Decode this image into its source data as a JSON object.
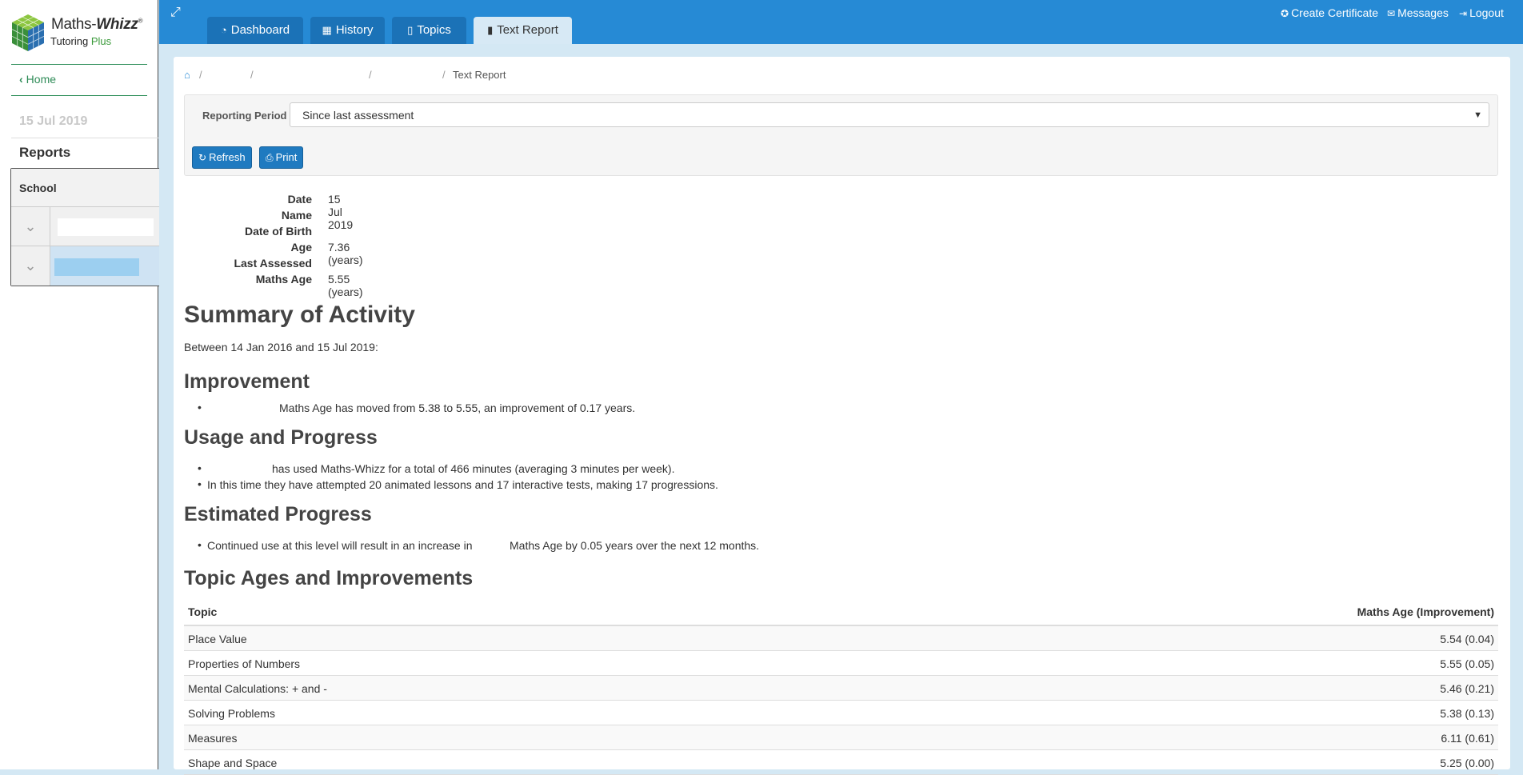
{
  "brand": {
    "name_prefix": "Maths-",
    "name_bold": "Whizz",
    "reg": "®",
    "sub_main": "Tutoring ",
    "sub_accent": "Plus"
  },
  "sidebar": {
    "home_label": "Home",
    "date": "15 Jul 2019",
    "reports_label": "Reports",
    "school_label": "School"
  },
  "topbar": {
    "tabs": [
      {
        "label": "Dashboard",
        "icon": "dashboard-icon"
      },
      {
        "label": "History",
        "icon": "calendar-icon"
      },
      {
        "label": "Topics",
        "icon": "book-icon"
      },
      {
        "label": "Text Report",
        "icon": "file-icon",
        "active": true
      }
    ],
    "right_links": [
      {
        "label": "Create Certificate",
        "icon": "certificate-icon"
      },
      {
        "label": "Messages",
        "icon": "envelope-icon"
      },
      {
        "label": "Logout",
        "icon": "logout-icon"
      }
    ]
  },
  "breadcrumb": {
    "current": "Text Report"
  },
  "filter": {
    "label": "Reporting Period",
    "selected": "Since last assessment",
    "refresh_label": "Refresh",
    "print_label": "Print"
  },
  "info": [
    {
      "key": "Date",
      "value": "15 Jul 2019"
    },
    {
      "key": "Name",
      "value": ""
    },
    {
      "key": "Date of Birth",
      "value": ""
    },
    {
      "key": "Age",
      "value": "7.36 (years)"
    },
    {
      "key": "Last Assessed",
      "value": ""
    },
    {
      "key": "Maths Age",
      "value": "5.55 (years)"
    }
  ],
  "summary": {
    "title": "Summary of Activity",
    "between": "Between 14 Jan 2016 and 15 Jul 2019:",
    "improvement_title": "Improvement",
    "improvement_text": "Maths Age has moved from 5.38 to 5.55, an improvement of 0.17 years.",
    "usage_title": "Usage and Progress",
    "usage_text_1": "has used Maths-Whizz for a total of 466 minutes (averaging 3 minutes per week).",
    "usage_text_2": "In this time they have attempted 20 animated lessons and 17 interactive tests, making 17 progressions.",
    "estimated_title": "Estimated Progress",
    "estimated_text_a": "Continued use at this level will result in an increase in",
    "estimated_text_b": "Maths Age by 0.05 years over the next 12 months."
  },
  "topic_table": {
    "title": "Topic Ages and Improvements",
    "col_topic": "Topic",
    "col_age": "Maths Age (Improvement)",
    "rows": [
      {
        "topic": "Place Value",
        "age": "5.54 (0.04)"
      },
      {
        "topic": "Properties of Numbers",
        "age": "5.55 (0.05)"
      },
      {
        "topic": "Mental Calculations: + and -",
        "age": "5.46 (0.21)"
      },
      {
        "topic": "Solving Problems",
        "age": "5.38 (0.13)"
      },
      {
        "topic": "Measures",
        "age": "6.11 (0.61)"
      },
      {
        "topic": "Shape and Space",
        "age": "5.25 (0.00)"
      }
    ]
  }
}
